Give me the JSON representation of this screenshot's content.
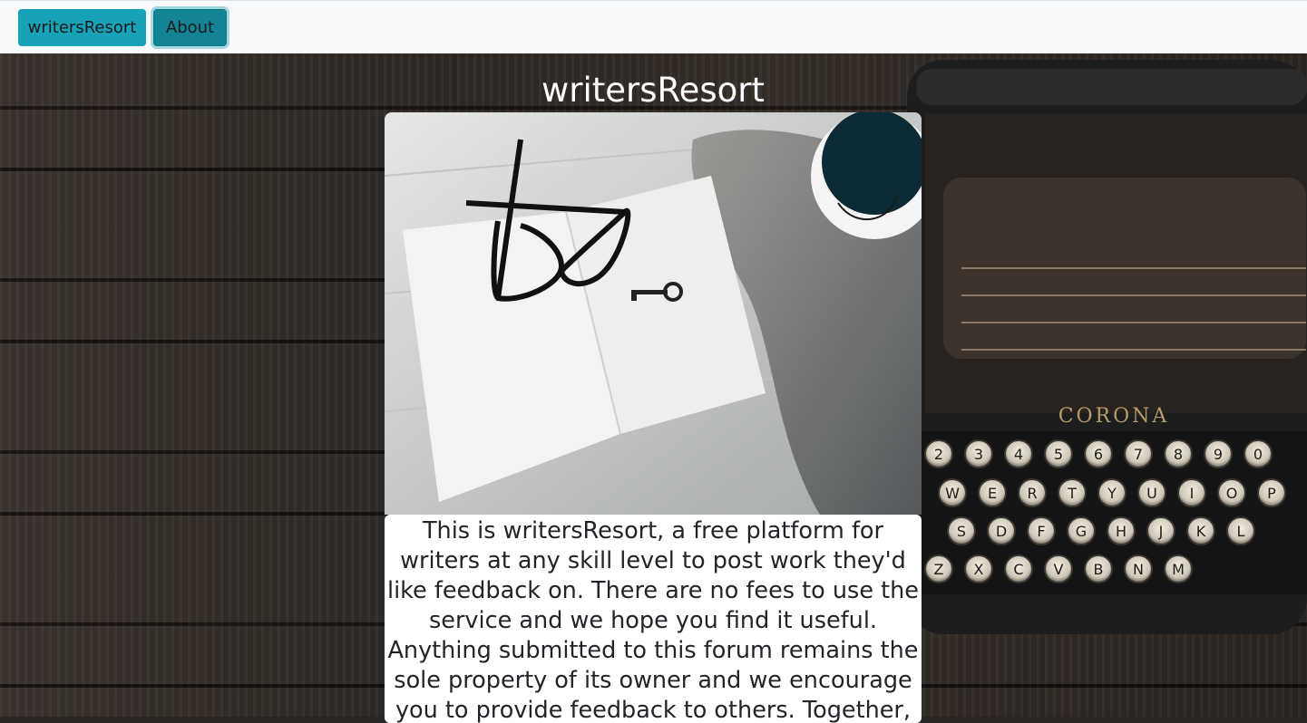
{
  "navbar": {
    "brand_label": "writersResort",
    "about_label": "About"
  },
  "main": {
    "title": "writersResort",
    "about_text": "This is writersResort, a free platform for writers at any skill level to post work they'd like feedback on. There are no fees to use the service and we hope you find it useful. Anything submitted to this forum remains the sole property of its owner and we encourage you to provide feedback to others. Together, we can"
  },
  "typewriter": {
    "brand_text": "CORONA",
    "number_keys": [
      "2",
      "3",
      "4",
      "5",
      "6",
      "7",
      "8",
      "9",
      "0"
    ],
    "row_keys_1": [
      "W",
      "E",
      "R",
      "T",
      "Y",
      "U",
      "I",
      "O",
      "P"
    ],
    "row_keys_2": [
      "S",
      "D",
      "F",
      "G",
      "H",
      "J",
      "K",
      "L"
    ],
    "row_keys_3": [
      "Z",
      "X",
      "C",
      "V",
      "B",
      "N",
      "M"
    ]
  },
  "colors": {
    "accent": "#17a2b8",
    "accent_active": "#138496",
    "navbar_bg": "#f8f9fa",
    "page_bg": "#2b2622"
  }
}
